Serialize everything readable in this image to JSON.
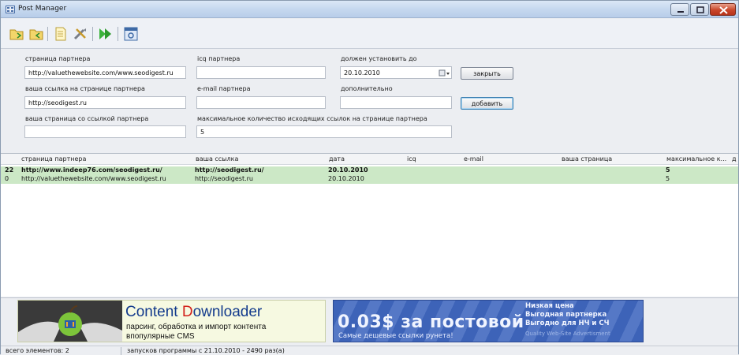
{
  "window": {
    "title": "Post Manager"
  },
  "toolbar": {
    "icons": [
      "folder-open-icon",
      "folder-export-icon",
      "new-document-icon",
      "tools-icon",
      "run-icon",
      "window-icon"
    ]
  },
  "form": {
    "partner_page_label": "страница партнера",
    "partner_page_value": "http://valuethewebsite.com/www.seodigest.ru",
    "icq_label": "icq партнера",
    "icq_value": "",
    "install_by_label": "должен установить до",
    "install_by_value": "20.10.2010",
    "close_button": "закрыть",
    "your_link_label": "ваша ссылка на странице партнера",
    "your_link_value": "http://seodigest.ru",
    "email_label": "e-mail партнера",
    "email_value": "",
    "extra_label": "дополнительно",
    "extra_value": "",
    "add_button": "добавить",
    "your_page_label": "ваша страница со ссылкой партнера",
    "your_page_value": "",
    "max_links_label": "максимальное количество исходящих ссылок на странице партнера",
    "max_links_value": "5"
  },
  "grid": {
    "columns": [
      "страница партнера",
      "ваша ссылка",
      "дата",
      "icq",
      "e-mail",
      "ваша страница",
      "максимальное к...",
      "д"
    ],
    "rows": [
      {
        "id": "22",
        "page": "http://www.indeep76.com/seodigest.ru/",
        "link": "http://seodigest.ru/",
        "date": "20.10.2010",
        "max": "5"
      },
      {
        "id": "0",
        "page": "http://valuethewebsite.com/www.seodigest.ru",
        "link": "http://seodigest.ru",
        "date": "20.10.2010",
        "max": "5"
      }
    ]
  },
  "ads": {
    "ad1_title_prefix": "Content ",
    "ad1_title_d": "D",
    "ad1_title_rest": "ownloader",
    "ad1_line1": "парсинг, обработка и импорт контента",
    "ad1_line2": "впопулярные CMS",
    "ad2_price": "0.03$ за постовой",
    "ad2_sub": "Самые дешевые ссылки рунета!",
    "ad2_r1": "Низкая цена",
    "ad2_r2": "Выгодная партнерка",
    "ad2_r3": "Выгодно для НЧ и СЧ",
    "ad2_r4": "Quality Web-Site Advertisment"
  },
  "status": {
    "elements": "всего элементов: 2",
    "launches": "запусков программы с 21.10.2010 - 2490 раз(а)"
  }
}
